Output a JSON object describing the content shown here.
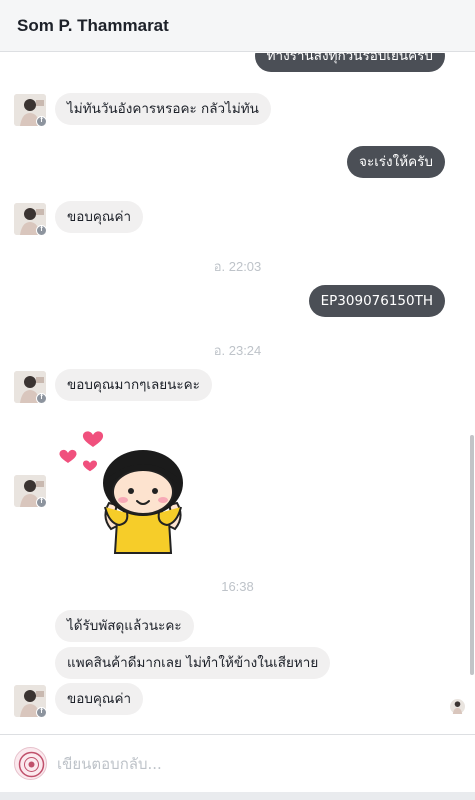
{
  "header": {
    "contact_name": "Som P. Thammarat"
  },
  "messages": {
    "m0": "ทางร้านส่งทุกวันรอบเย็นครับ",
    "m1": "ไม่ทันวันอังคารหรอคะ กลัวไม่ทัน",
    "m2": "จะเร่งให้ครับ",
    "m3": "ขอบคุณค่า",
    "m4": "EP309076150TH",
    "m5": "ขอบคุณมากๆเลยนะคะ",
    "m6": "ได้รับพัสดุแล้วนะคะ",
    "m7": "แพคสินค้าดีมากเลย ไม่ทำให้ข้างในเสียหาย",
    "m8": "ขอบคุณค่า"
  },
  "timestamps": {
    "t1": "อ. 22:03",
    "t2": "อ. 23:24",
    "t3": "16:38"
  },
  "avatar_badge": "f",
  "composer": {
    "placeholder": "เขียนตอบกลับ..."
  },
  "colors": {
    "outgoing_bubble": "#4b4f56",
    "incoming_bubble": "#f1f0f0",
    "timestamp": "#bec3c9",
    "header_bg": "#f5f6f7"
  }
}
